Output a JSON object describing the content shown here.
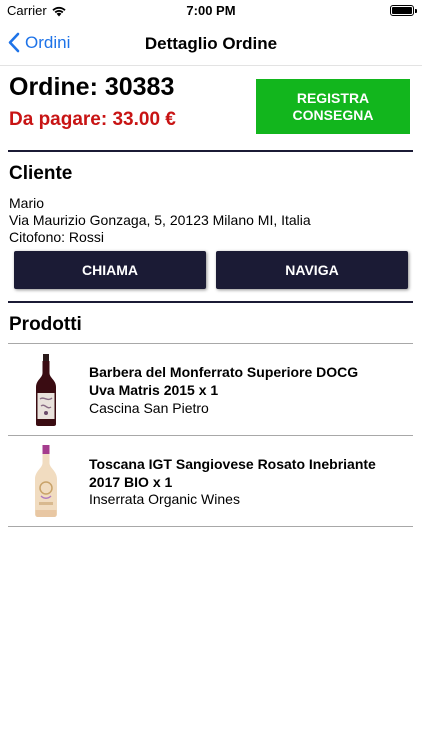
{
  "status_bar": {
    "carrier": "Carrier",
    "time": "7:00 PM"
  },
  "nav": {
    "back_label": "Ordini",
    "title": "Dettaglio Ordine"
  },
  "order": {
    "title": "Ordine: 30383",
    "due": "Da pagare: 33.00 €",
    "register_line1": "REGISTRA",
    "register_line2": "CONSEGNA"
  },
  "client": {
    "heading": "Cliente",
    "name": "Mario",
    "address": "Via Maurizio Gonzaga, 5, 20123 Milano MI, Italia",
    "intercom": "Citofono: Rossi",
    "call_label": "CHIAMA",
    "navigate_label": "NAVIGA"
  },
  "products": {
    "heading": "Prodotti",
    "items": [
      {
        "name_line1": "Barbera del Monferrato Superiore DOCG",
        "name_line2": "Uva Matris 2015 x 1",
        "vendor": "Cascina San Pietro",
        "icon": "red-wine-bottle-icon"
      },
      {
        "name_line1": "Toscana IGT Sangiovese Rosato Inebriante",
        "name_line2": "2017 BIO x 1",
        "vendor": "Inserrata Organic Wines",
        "icon": "rose-wine-bottle-icon"
      }
    ]
  },
  "colors": {
    "accent_blue": "#1e73e8",
    "due_red": "#c81414",
    "register_green": "#12b61d",
    "dark_navy": "#1b1b35"
  }
}
